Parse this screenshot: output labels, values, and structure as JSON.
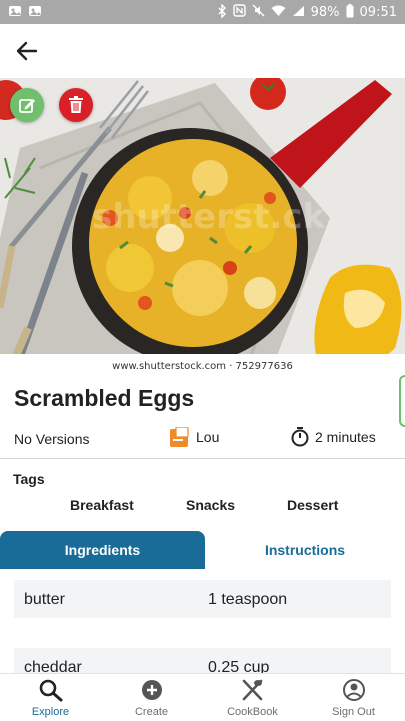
{
  "status_bar": {
    "battery": "98%",
    "time": "09:51",
    "icons": [
      "gallery-icon",
      "gallery-icon",
      "bluetooth-icon",
      "nfc-icon",
      "mute-icon",
      "wifi-icon",
      "signal-icon",
      "battery-icon"
    ]
  },
  "header": {
    "back_icon": "arrow-left-icon"
  },
  "hero": {
    "watermark": "www.shutterstock.com · 752977636",
    "edit_icon": "pencil-icon",
    "delete_icon": "trash-icon"
  },
  "recipe": {
    "title": "Scrambled Eggs",
    "versions": "No Versions",
    "author": "Lou",
    "duration": "2 minutes"
  },
  "tags": {
    "label": "Tags",
    "items": [
      "Breakfast",
      "Snacks",
      "Dessert"
    ]
  },
  "tabs": {
    "ingredients": "Ingredients",
    "instructions": "Instructions",
    "active": "Ingredients"
  },
  "ingredients": [
    {
      "name": "butter",
      "quantity": "1 teaspoon"
    },
    {
      "name": "cheddar",
      "quantity": "0.25 cup"
    }
  ],
  "bottom_nav": {
    "items": [
      {
        "label": "Explore",
        "icon": "search-icon",
        "active": true
      },
      {
        "label": "Create",
        "icon": "plus-circle-icon",
        "active": false
      },
      {
        "label": "CookBook",
        "icon": "utensils-icon",
        "active": false
      },
      {
        "label": "Sign Out",
        "icon": "account-icon",
        "active": false
      }
    ]
  },
  "colors": {
    "accent": "#186c97",
    "edit_green": "#6fbf6c",
    "delete_red": "#d92027",
    "status_bar": "#a8a8a8"
  }
}
